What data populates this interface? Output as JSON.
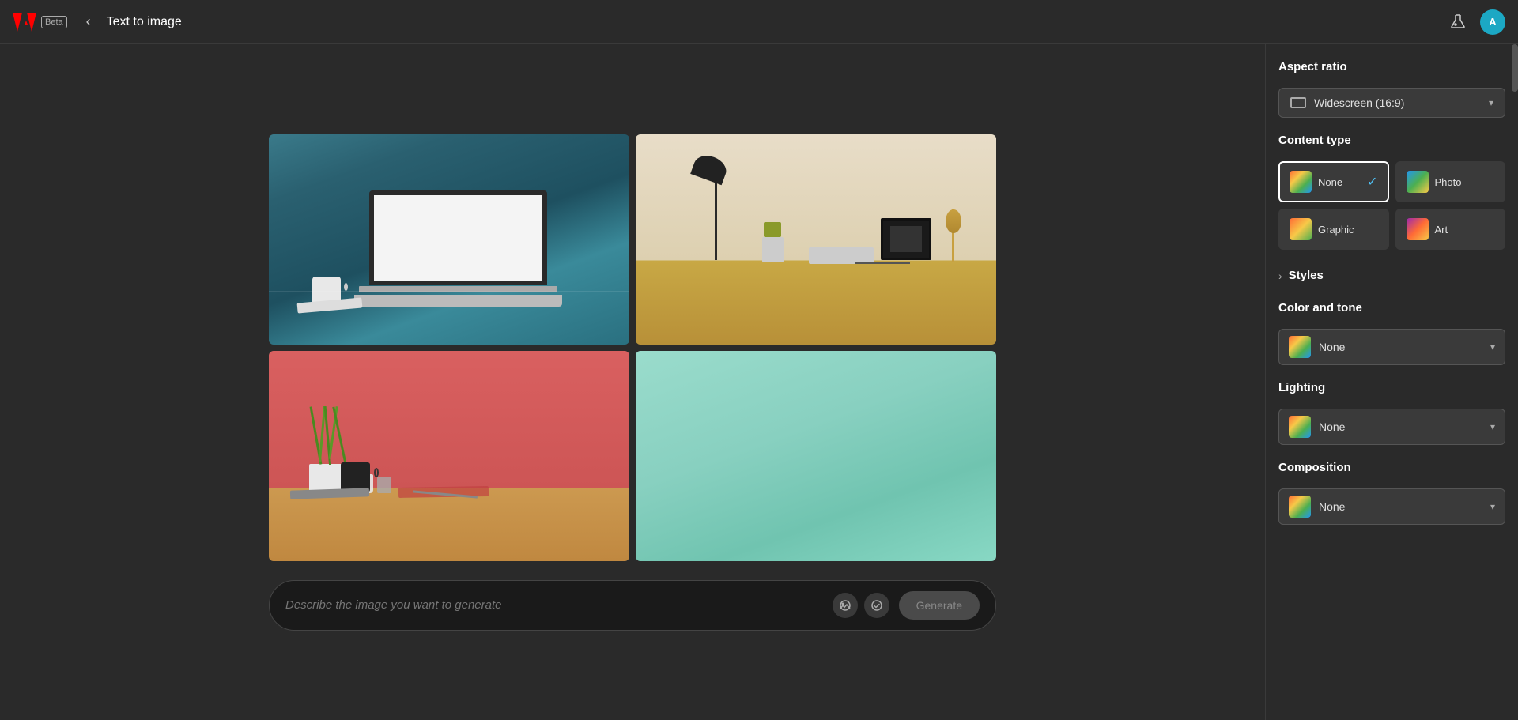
{
  "app": {
    "name": "Adobe",
    "badge": "Beta",
    "back_label": "‹",
    "title": "Text to image",
    "flask_icon": "flask-icon",
    "avatar_initials": "A"
  },
  "prompt": {
    "placeholder": "Describe the image you want to generate",
    "generate_label": "Generate"
  },
  "panel": {
    "aspect_ratio": {
      "title": "Aspect ratio",
      "selected_label": "Widescreen (16:9)",
      "chevron": "▾"
    },
    "content_type": {
      "title": "Content type",
      "options": [
        {
          "id": "none",
          "label": "None",
          "selected": true
        },
        {
          "id": "photo",
          "label": "Photo",
          "selected": false
        },
        {
          "id": "graphic",
          "label": "Graphic",
          "selected": false
        },
        {
          "id": "art",
          "label": "Art",
          "selected": false
        }
      ]
    },
    "styles": {
      "label": "Styles",
      "chevron": "›"
    },
    "color_and_tone": {
      "title": "Color and tone",
      "selected_label": "None",
      "chevron": "▾"
    },
    "lighting": {
      "title": "Lighting",
      "selected_label": "None",
      "chevron": "▾"
    },
    "composition": {
      "title": "Composition",
      "selected_label": "None",
      "chevron": "▾"
    }
  }
}
